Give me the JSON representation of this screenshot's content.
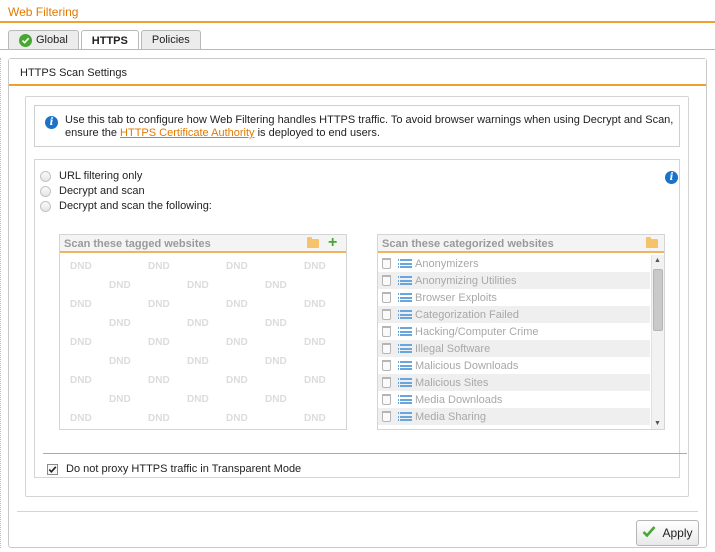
{
  "window": {
    "title": "Web Filtering"
  },
  "tabs": [
    {
      "label": "Global",
      "icon": "green-check-icon",
      "active": false
    },
    {
      "label": "HTTPS",
      "active": true
    },
    {
      "label": "Policies",
      "active": false
    }
  ],
  "panel": {
    "title": "HTTPS Scan Settings",
    "info": {
      "text_before": "Use this tab to configure how Web Filtering handles HTTPS traffic. To avoid browser warnings when using Decrypt and Scan, ensure the ",
      "link": "HTTPS Certificate Authority",
      "text_after": " is deployed to end users."
    },
    "options": [
      {
        "label": "URL filtering only",
        "selected": false
      },
      {
        "label": "Decrypt and scan",
        "selected": false
      },
      {
        "label": "Decrypt and scan the following:",
        "selected": false
      }
    ],
    "tagged_list": {
      "title": "Scan these tagged websites",
      "placeholder": "DND"
    },
    "categorized_list": {
      "title": "Scan these categorized websites",
      "items": [
        "Anonymizers",
        "Anonymizing Utilities",
        "Browser Exploits",
        "Categorization Failed",
        "Hacking/Computer Crime",
        "Illegal Software",
        "Malicious Downloads",
        "Malicious Sites",
        "Media Downloads",
        "Media Sharing"
      ]
    },
    "transparent_checkbox": {
      "label": "Do not proxy HTTPS traffic in Transparent Mode",
      "checked": true
    }
  },
  "footer": {
    "apply_label": "Apply"
  },
  "colors": {
    "accent": "#f0a030",
    "link": "#e07b00",
    "info": "#1a73c8",
    "success": "#46a832"
  }
}
